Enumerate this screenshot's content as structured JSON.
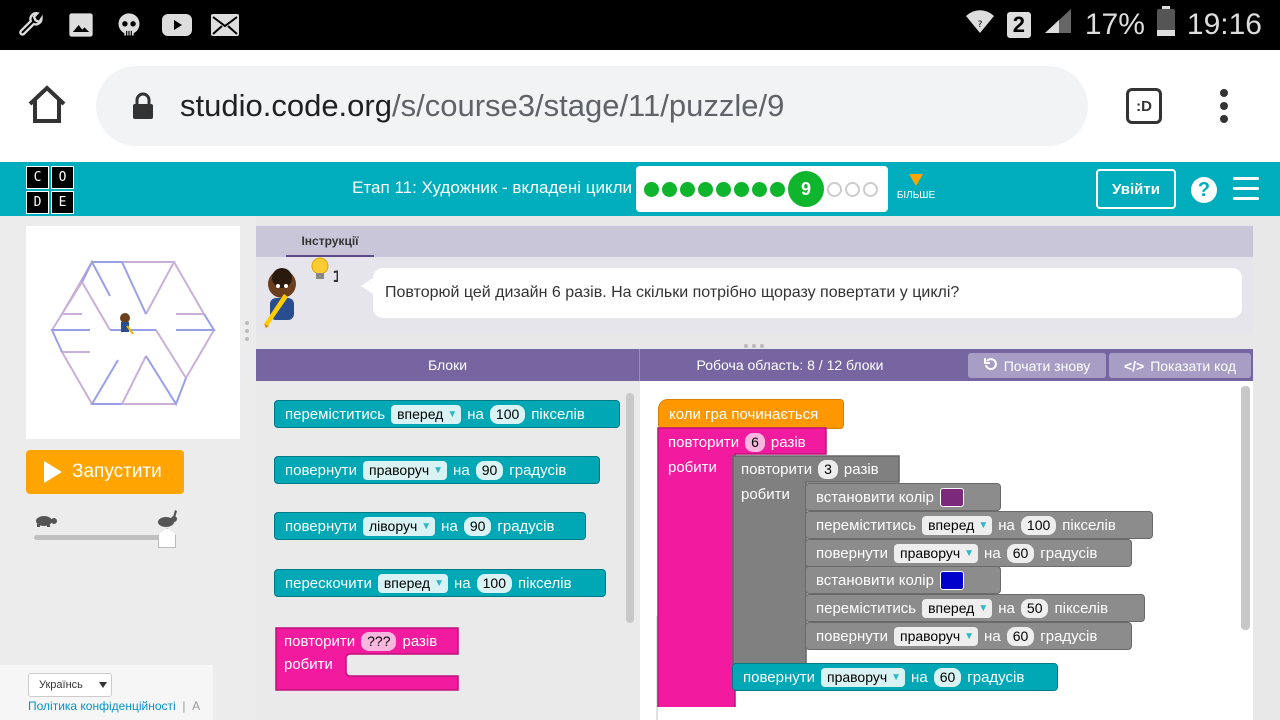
{
  "status_bar": {
    "battery_percent": "17%",
    "time": "19:16",
    "sim_slot": "2",
    "icons": [
      "wrench-icon",
      "image-icon",
      "skull-icon",
      "youtube-icon",
      "mail-icon",
      "wifi-icon",
      "signal-icon",
      "battery-icon"
    ]
  },
  "browser": {
    "url_host": "studio.code.org",
    "url_path": "/s/course3/stage/11/puzzle/9",
    "tab_badge": ":D"
  },
  "header": {
    "logo_letters": [
      "C",
      "O",
      "D",
      "E"
    ],
    "stage_title": "Етап 11: Художник - вкладені цикли",
    "current_puzzle": "9",
    "completed_dots": 8,
    "remaining_dots": 3,
    "more_label": "БІЛЬШЕ",
    "signin_label": "Увійти",
    "help_label": "?"
  },
  "left": {
    "run_label": "Запустити",
    "speed_value": 1.0,
    "language": "Українсь",
    "privacy_link": "Політика конфіденційності",
    "footer_sep": "|",
    "footer_cut": "А"
  },
  "instructions": {
    "tab_label": "Інструкції",
    "hint_count": "1",
    "text": "Повторюй цей дизайн 6 разів. На скільки потрібно щоразу повертати у циклі?"
  },
  "workspace_header": {
    "blocks_label": "Блоки",
    "workspace_label": "Робоча область: 8 / 12 блоки",
    "reset_label": "Почати знову",
    "show_code_label": "Показати код"
  },
  "toolbox": {
    "move": {
      "label": "переміститись",
      "dir": "вперед",
      "on": "на",
      "value": "100",
      "unit": "пікселів"
    },
    "turn_right": {
      "label": "повернути",
      "dir": "праворуч",
      "on": "на",
      "value": "90",
      "unit": "градусів"
    },
    "turn_left": {
      "label": "повернути",
      "dir": "ліворуч",
      "on": "на",
      "value": "90",
      "unit": "градусів"
    },
    "jump": {
      "label": "перескочити",
      "dir": "вперед",
      "on": "на",
      "value": "100",
      "unit": "пікселів"
    },
    "repeat": {
      "label": "повторити",
      "value": "???",
      "unit": "разів",
      "do": "робити"
    }
  },
  "program": {
    "start": "коли гра починається",
    "outer_repeat": {
      "label": "повторити",
      "value": "6",
      "unit": "разів",
      "do": "робити"
    },
    "inner_repeat": {
      "label": "повторити",
      "value": "3",
      "unit": "разів",
      "do": "робити"
    },
    "set_color_1": {
      "label": "встановити колір",
      "color": "#7b2a7b"
    },
    "move_1": {
      "label": "переміститись",
      "dir": "вперед",
      "on": "на",
      "value": "100",
      "unit": "пікселів"
    },
    "turn_1": {
      "label": "повернути",
      "dir": "праворуч",
      "on": "на",
      "value": "60",
      "unit": "градусів"
    },
    "set_color_2": {
      "label": "встановити колір",
      "color": "#0000cc"
    },
    "move_2": {
      "label": "переміститись",
      "dir": "вперед",
      "on": "на",
      "value": "50",
      "unit": "пікселів"
    },
    "turn_2": {
      "label": "повернути",
      "dir": "праворуч",
      "on": "на",
      "value": "60",
      "unit": "градусів"
    },
    "turn_outer": {
      "label": "повернути",
      "dir": "праворуч",
      "on": "на",
      "value": "60",
      "unit": "градусів"
    }
  },
  "colors": {
    "codeorg_teal": "#00adbc",
    "run_orange": "#ffa400",
    "progress_green": "#0fb52d",
    "workspace_purple": "#7665a0"
  }
}
